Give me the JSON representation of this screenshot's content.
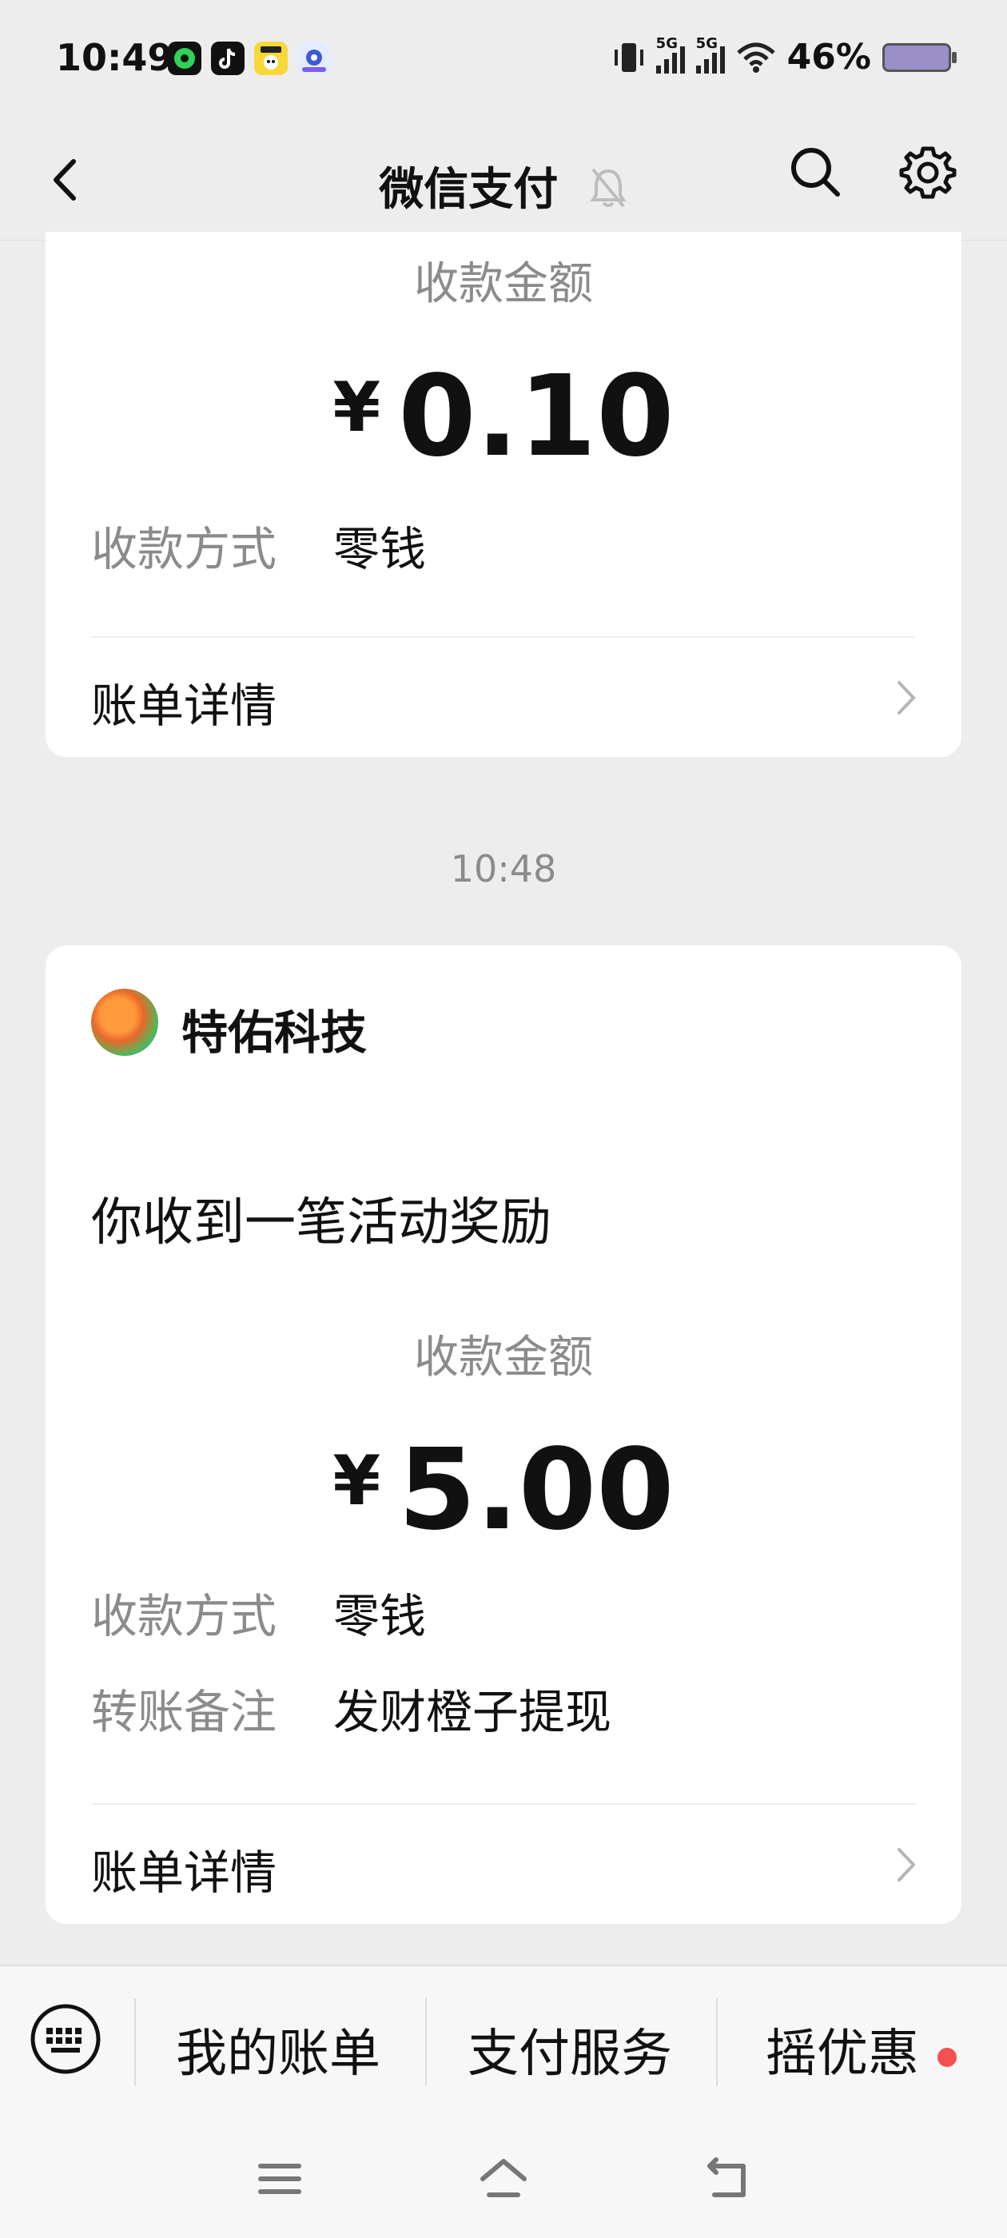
{
  "status_bar": {
    "time": "10:49",
    "network_1": "5G",
    "network_2": "5G",
    "battery": "46%"
  },
  "header": {
    "title": "微信支付"
  },
  "card_1": {
    "amount_label": "收款金额",
    "currency": "¥",
    "amount": "0.10",
    "method_label": "收款方式",
    "method_value": "零钱",
    "detail_link": "账单详情"
  },
  "timestamp": "10:48",
  "card_2": {
    "merchant": "特佑科技",
    "headline": "你收到一笔活动奖励",
    "amount_label": "收款金额",
    "currency": "¥",
    "amount": "5.00",
    "method_label": "收款方式",
    "method_value": "零钱",
    "note_label": "转账备注",
    "note_value": "发财橙子提现",
    "detail_link": "账单详情"
  },
  "bottom_menu": {
    "items": [
      "我的账单",
      "支付服务",
      "摇优惠"
    ]
  },
  "colors": {
    "background": "#ededed",
    "card": "#ffffff",
    "muted_text": "#8b8b8b",
    "badge_red": "#f55050"
  }
}
